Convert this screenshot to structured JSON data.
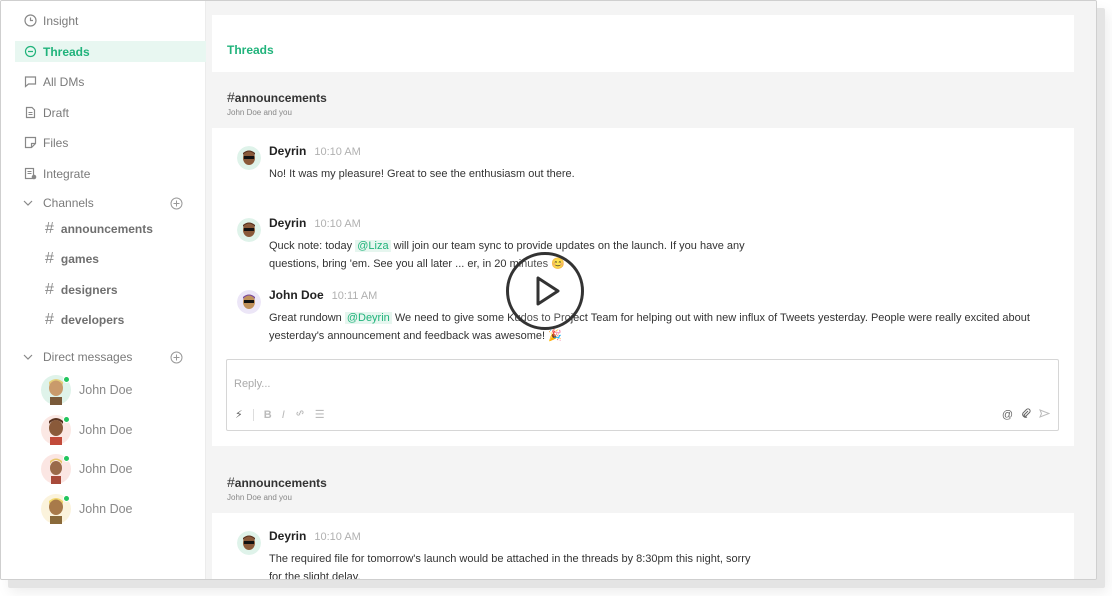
{
  "sidebar": {
    "nav": [
      {
        "label": "Insight",
        "icon": "clock-icon"
      },
      {
        "label": "Threads",
        "icon": "chat-bubble-icon",
        "active": true
      },
      {
        "label": "All DMs",
        "icon": "message-icon"
      },
      {
        "label": "Draft",
        "icon": "document-icon"
      },
      {
        "label": "Files",
        "icon": "file-icon"
      },
      {
        "label": "Integrate",
        "icon": "integrate-icon"
      }
    ],
    "channels_label": "Channels",
    "channels": [
      "announcements",
      "games",
      "designers",
      "developers"
    ],
    "dms_label": "Direct messages",
    "dms": [
      "John Doe",
      "John Doe",
      "John Doe",
      "John Doe"
    ]
  },
  "main": {
    "title": "Threads",
    "threads": [
      {
        "channel": "announcements",
        "participants": "John Doe and you",
        "messages": [
          {
            "author": "Deyrin",
            "time": "10:10 AM",
            "lines": [
              "No! It was my pleasure! Great to see the enthusiasm out there."
            ]
          },
          {
            "author": "Deyrin",
            "time": "10:10 AM",
            "pre": "Quck note: today ",
            "mention": "@Liza",
            "post": " will join our team sync to provide updates on the launch. If you have any",
            "line2": "questions, bring 'em. See you all later ... er, in 20 minutes 😊"
          },
          {
            "author": "John Doe",
            "time": "10:11 AM",
            "pre": "Great rundown ",
            "mention": "@Deyrin",
            "post": " We need to give some Kudos to Project Team for helping out with new influx of Tweets yesterday. People were really excited about",
            "line2": "yesterday's announcement and feedback was awesome! 🎉"
          }
        ],
        "reply_placeholder": "Reply..."
      },
      {
        "channel": "announcements",
        "participants": "John Doe and you",
        "messages": [
          {
            "author": "Deyrin",
            "time": "10:10 AM",
            "lines": [
              "The required file for tomorrow's launch would be attached in the threads by 8:30pm this night, sorry",
              "for the slight delay."
            ]
          }
        ]
      }
    ]
  },
  "colors": {
    "accent": "#20b37b",
    "active_bg": "#e8f7f1",
    "online": "#22c55e"
  }
}
